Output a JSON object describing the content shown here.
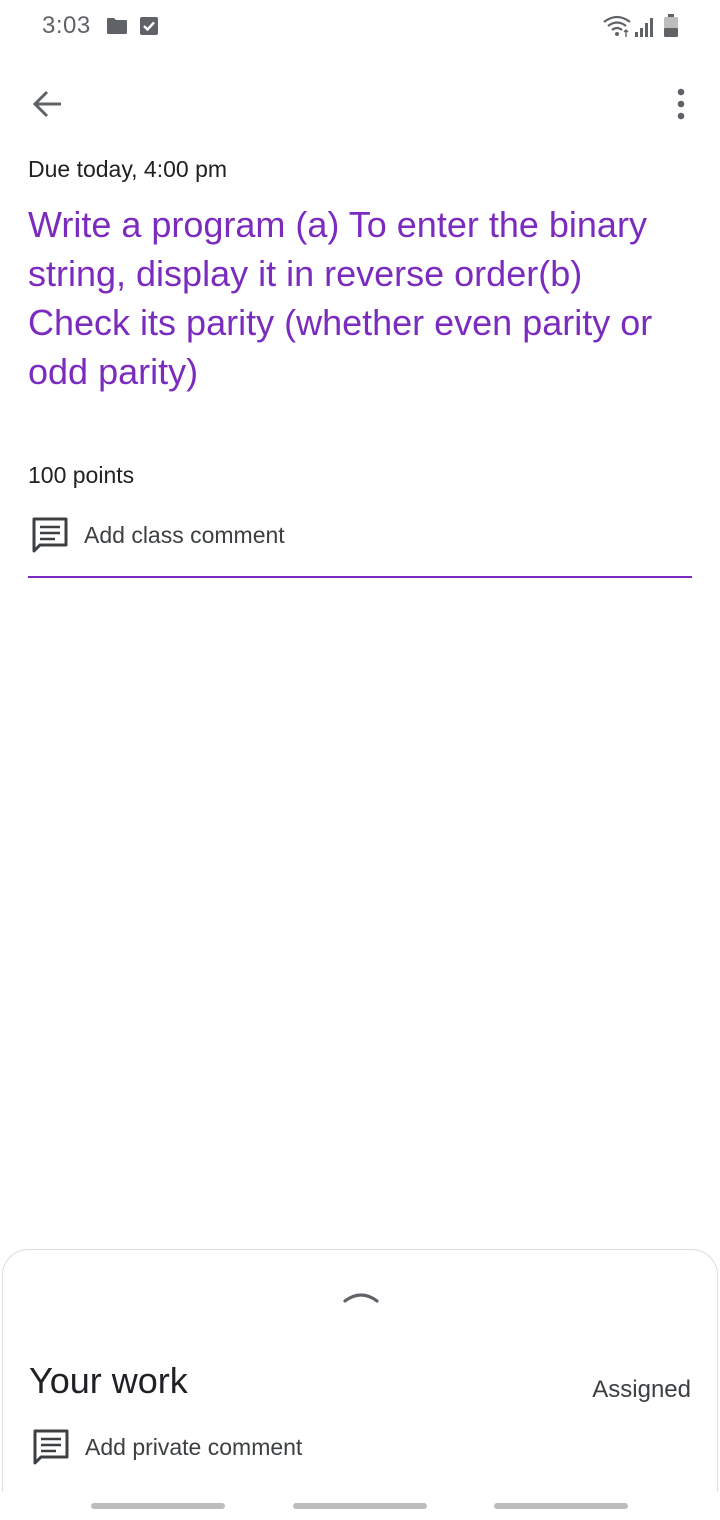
{
  "status_bar": {
    "time": "3:03",
    "icons": [
      "folder-icon",
      "checkbox-icon",
      "wifi-icon",
      "signal-icon",
      "battery-icon"
    ]
  },
  "app_bar": {
    "back_icon": "arrow-back-icon",
    "more_icon": "more-vert-icon"
  },
  "assignment": {
    "due": "Due today, 4:00 pm",
    "title": "Write a program (a) To enter the binary string, display it in reverse order(b) Check its parity (whether even parity or odd parity)",
    "points": "100 points",
    "class_comment_label": "Add class comment"
  },
  "sheet": {
    "heading": "Your work",
    "status": "Assigned",
    "private_comment_label": "Add private comment"
  },
  "colors": {
    "accent": "#7b2cbf",
    "text": "#202124",
    "secondary_text": "#3c4043",
    "icon": "#5f6368",
    "border": "#dadce0"
  }
}
